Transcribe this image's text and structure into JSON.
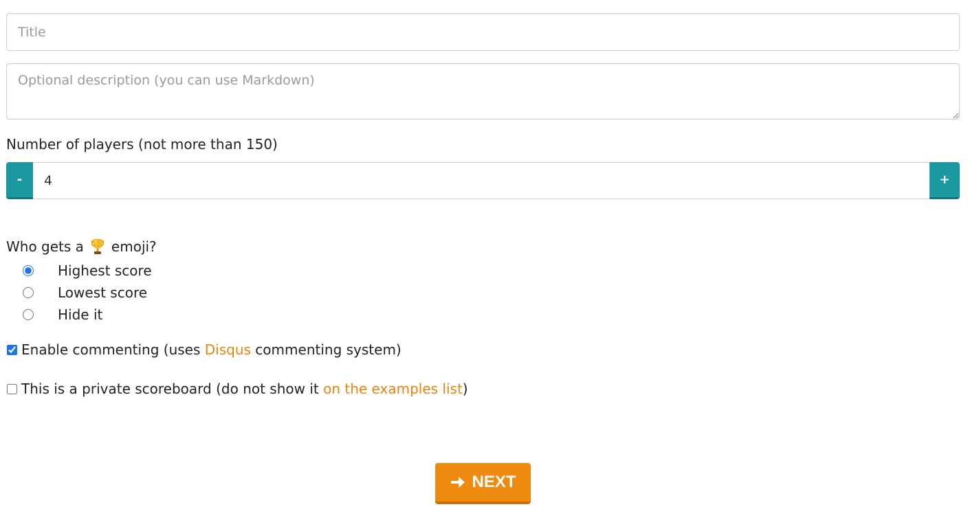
{
  "form": {
    "title_placeholder": "Title",
    "title_value": "",
    "description_placeholder": "Optional description (you can use Markdown)",
    "description_value": "",
    "players_label": "Number of players (not more than 150)",
    "players_value": "4",
    "minus_label": "-",
    "plus_label": "+"
  },
  "trophy": {
    "question_prefix": "Who gets a",
    "question_suffix": "emoji?",
    "icon": "trophy-icon",
    "options": [
      {
        "label": "Highest score",
        "selected": true
      },
      {
        "label": "Lowest score",
        "selected": false
      },
      {
        "label": "Hide it",
        "selected": false
      }
    ]
  },
  "commenting": {
    "checked": true,
    "text_before": "Enable commenting (uses ",
    "link_text": "Disqus",
    "text_after": " commenting system)"
  },
  "private": {
    "checked": false,
    "text_before": "This is a private scoreboard (do not show it ",
    "link_text": "on the examples list",
    "text_after": ")"
  },
  "next_button": {
    "label": "NEXT",
    "icon": "arrow-right-icon"
  },
  "colors": {
    "teal": "#1a9aa0",
    "orange": "#ee8a10",
    "link": "#e8830c"
  }
}
